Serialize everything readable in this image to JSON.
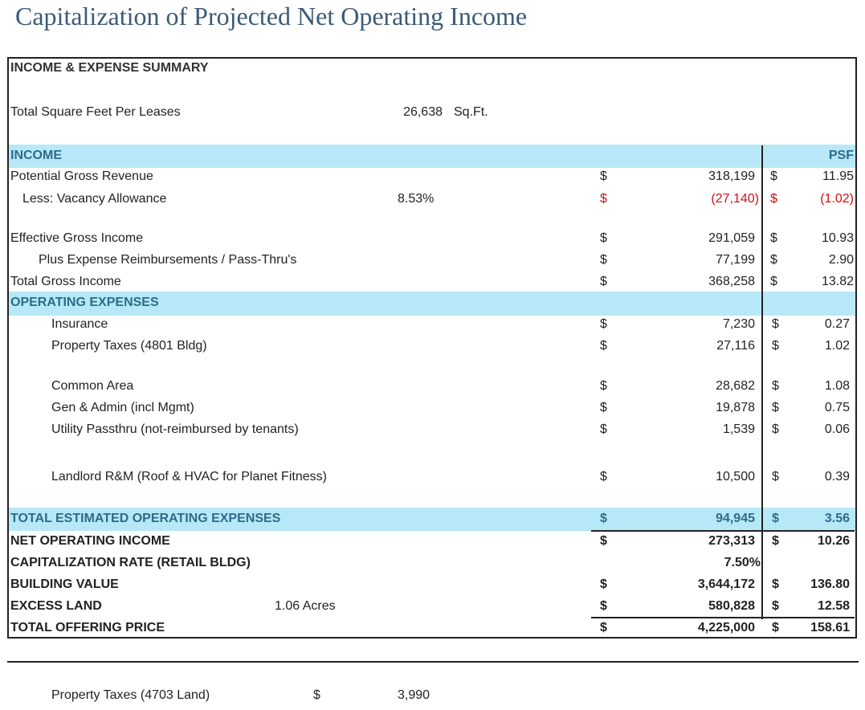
{
  "title": "Capitalization of Projected Net Operating Income",
  "summary_header": "INCOME & EXPENSE SUMMARY",
  "sqft": {
    "label": "Total Square Feet Per Leases",
    "value": "26,638",
    "unit": "Sq.Ft."
  },
  "income": {
    "header": "INCOME",
    "psf_header": "PSF",
    "potential_gross": {
      "label": "Potential Gross Revenue",
      "cur": "$",
      "amount": "318,199",
      "psf_cur": "$",
      "psf": "11.95"
    },
    "vacancy": {
      "label": "Less: Vacancy Allowance",
      "rate": "8.53%",
      "cur": "$",
      "amount": "(27,140)",
      "psf_cur": "$",
      "psf": "(1.02)"
    },
    "effective_gross": {
      "label": "Effective Gross Income",
      "cur": "$",
      "amount": "291,059",
      "psf_cur": "$",
      "psf": "10.93"
    },
    "reimbursements": {
      "label": "Plus Expense Reimbursements / Pass-Thru's",
      "cur": "$",
      "amount": "77,199",
      "psf_cur": "$",
      "psf": "2.90"
    },
    "total_gross": {
      "label": "Total Gross Income",
      "cur": "$",
      "amount": "368,258",
      "psf_cur": "$",
      "psf": "13.82"
    }
  },
  "expenses": {
    "header": "OPERATING EXPENSES",
    "insurance": {
      "label": "Insurance",
      "cur": "$",
      "amount": "7,230",
      "psf_cur": "$",
      "psf": "0.27"
    },
    "property_taxes": {
      "label": "Property Taxes (4801 Bldg)",
      "cur": "$",
      "amount": "27,116",
      "psf_cur": "$",
      "psf": "1.02"
    },
    "common_area": {
      "label": "Common Area",
      "cur": "$",
      "amount": "28,682",
      "psf_cur": "$",
      "psf": "1.08"
    },
    "gen_admin": {
      "label": "Gen & Admin (incl Mgmt)",
      "cur": "$",
      "amount": "19,878",
      "psf_cur": "$",
      "psf": "0.75"
    },
    "utility": {
      "label": "Utility Passthru (not-reimbursed by tenants)",
      "cur": "$",
      "amount": "1,539",
      "psf_cur": "$",
      "psf": "0.06"
    },
    "landlord_rm": {
      "label": "Landlord R&M (Roof & HVAC for Planet Fitness)",
      "cur": "$",
      "amount": "10,500",
      "psf_cur": "$",
      "psf": "0.39"
    },
    "total": {
      "label": "TOTAL ESTIMATED OPERATING EXPENSES",
      "cur": "$",
      "amount": "94,945",
      "psf_cur": "$",
      "psf": "3.56"
    }
  },
  "noi": {
    "label": "NET OPERATING INCOME",
    "cur": "$",
    "amount": "273,313",
    "psf_cur": "$",
    "psf": "10.26"
  },
  "cap_rate": {
    "label": "CAPITALIZATION RATE (RETAIL BLDG)",
    "value": "7.50%"
  },
  "building_value": {
    "label": "BUILDING VALUE",
    "cur": "$",
    "amount": "3,644,172",
    "psf_cur": "$",
    "psf": "136.80"
  },
  "excess_land": {
    "label": "EXCESS LAND",
    "acres": "1.06 Acres",
    "cur": "$",
    "amount": "580,828",
    "psf_cur": "$",
    "psf": "12.58"
  },
  "offering_price": {
    "label": "TOTAL OFFERING PRICE",
    "cur": "$",
    "amount": "4,225,000",
    "psf_cur": "$",
    "psf": "158.61"
  },
  "footer_row": {
    "label": "Property Taxes (4703 Land)",
    "cur": "$",
    "amount": "3,990"
  },
  "colors": {
    "band": "#b7e8f7",
    "header_text": "#2e6b8a",
    "negative": "#d01010",
    "title": "#3b5a78"
  }
}
